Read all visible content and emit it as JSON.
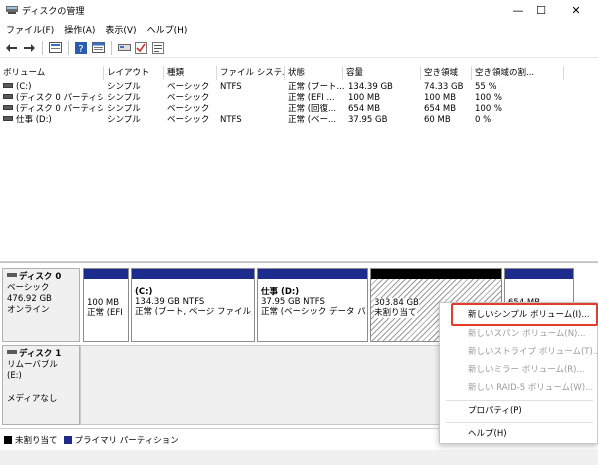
{
  "window": {
    "title": "ディスクの管理",
    "minimize": "—",
    "maximize": "☐",
    "close": "✕"
  },
  "menu": [
    "ファイル(F)",
    "操作(A)",
    "表示(V)",
    "ヘルプ(H)"
  ],
  "toolbar_icons": [
    "back-arrow-icon",
    "forward-arrow-icon",
    "disk-list-icon",
    "help-icon",
    "volume-list-icon",
    "properties-icon",
    "checkmark-icon",
    "settings-icon"
  ],
  "table": {
    "columns": [
      "ボリューム",
      "レイアウト",
      "種類",
      "ファイル システム",
      "状態",
      "容量",
      "空き領域",
      "空き領域の割..."
    ],
    "rows": [
      [
        "(C:)",
        "シンプル",
        "ベーシック",
        "NTFS",
        "正常 (ブート...",
        "134.39 GB",
        "74.33 GB",
        "55 %"
      ],
      [
        "(ディスク 0 パーティシ...",
        "シンプル",
        "ベーシック",
        "",
        "正常 (EFI ...",
        "100 MB",
        "100 MB",
        "100 %"
      ],
      [
        "(ディスク 0 パーティシ...",
        "シンプル",
        "ベーシック",
        "",
        "正常 (回復...",
        "654 MB",
        "654 MB",
        "100 %"
      ],
      [
        "仕事 (D:)",
        "シンプル",
        "ベーシック",
        "NTFS",
        "正常 (ベー...",
        "37.95 GB",
        "60 MB",
        "0 %"
      ]
    ]
  },
  "disk0": {
    "name": "ディスク 0",
    "type": "ベーシック",
    "size": "476.92 GB",
    "status": "オンライン",
    "partitions": [
      {
        "title": "",
        "size": "100 MB",
        "status": "正常 (EFI"
      },
      {
        "title": "(C:)",
        "size": "134.39 GB NTFS",
        "status": "正常 (ブート, ページ ファイル, ク"
      },
      {
        "title": "仕事 (D:)",
        "size": "37.95 GB NTFS",
        "status": "正常 (ベーシック データ パー"
      },
      {
        "title": "",
        "size": "303.84 GB",
        "status": "未割り当て"
      },
      {
        "title": "",
        "size": "654 MB",
        "status": ""
      }
    ]
  },
  "disk1": {
    "name": "ディスク 1",
    "type": "リムーバブル (E:)",
    "status": "メディアなし"
  },
  "legend": {
    "unallocated": "未割り当て",
    "primary": "プライマリ パーティション"
  },
  "context_menu": {
    "items": [
      {
        "label": "新しいシンプル ボリューム(I)...",
        "enabled": true
      },
      {
        "label": "新しいスパン ボリューム(N)...",
        "enabled": false
      },
      {
        "label": "新しいストライプ ボリューム(T)...",
        "enabled": false
      },
      {
        "label": "新しいミラー ボリューム(R)...",
        "enabled": false
      },
      {
        "label": "新しい RAID-5 ボリューム(W)...",
        "enabled": false
      },
      {
        "label": "プロパティ(P)",
        "enabled": true
      },
      {
        "label": "ヘルプ(H)",
        "enabled": true
      }
    ]
  },
  "colors": {
    "primary_partition": "#1c2c8c",
    "unallocated": "#000000",
    "highlight": "#e53b2c"
  }
}
